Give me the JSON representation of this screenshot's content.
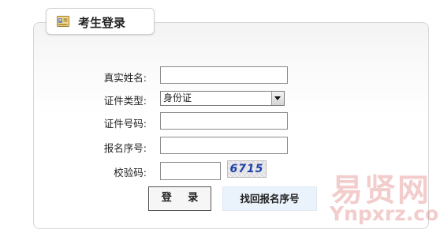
{
  "tab": {
    "title": "考生登录",
    "icon": "id-card-icon"
  },
  "form": {
    "name_label": "真实姓名:",
    "name_value": "",
    "id_type_label": "证件类型:",
    "id_type_value": "身份证",
    "id_number_label": "证件号码:",
    "id_number_value": "",
    "reg_no_label": "报名序号:",
    "reg_no_value": "",
    "captcha_label": "校验码:",
    "captcha_value": "",
    "captcha_text": "6715"
  },
  "buttons": {
    "login": "登 录",
    "find_reg_no": "找回报名序号"
  },
  "watermark": {
    "text_cn": "易贤网",
    "text_en": "Ynpxrz.com"
  }
}
